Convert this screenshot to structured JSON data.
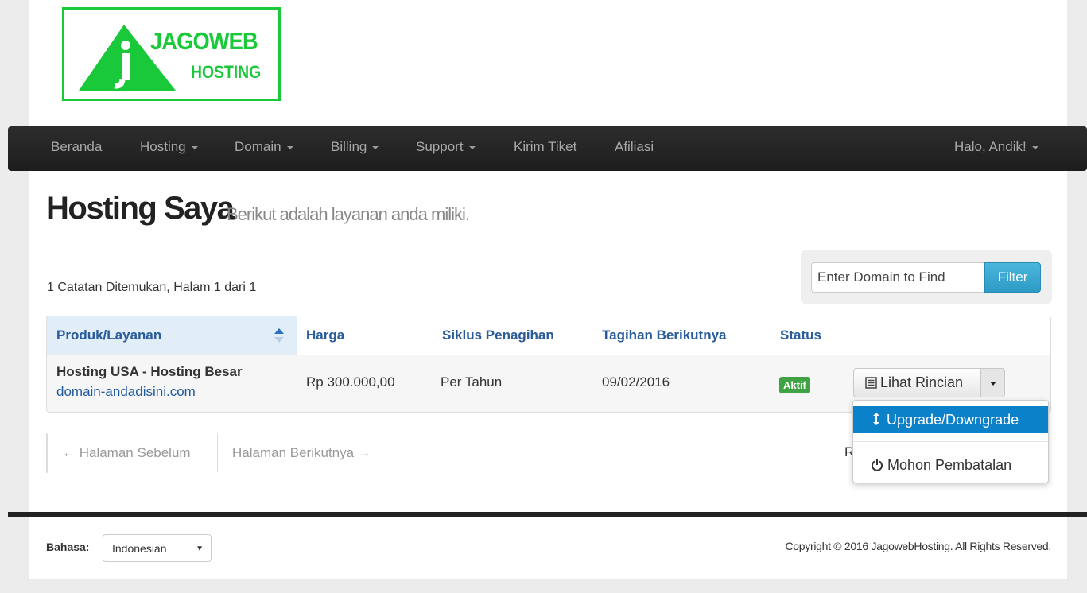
{
  "logo": {
    "line1": "JAGOWEB",
    "line2": "HOSTING",
    "brand_color": "#19c93a"
  },
  "nav": {
    "items": [
      {
        "label": "Beranda"
      },
      {
        "label": "Hosting"
      },
      {
        "label": "Domain"
      },
      {
        "label": "Billing"
      },
      {
        "label": "Support"
      },
      {
        "label": "Kirim Tiket"
      },
      {
        "label": "Afiliasi"
      }
    ],
    "user": "Halo, Andik!"
  },
  "page": {
    "title": "Hosting Saya",
    "subtitle": "Berikut adalah layanan anda miliki."
  },
  "records": "1 Catatan Ditemukan, Halam 1 dari 1",
  "filter": {
    "placeholder": "Enter Domain to Find",
    "button": "Filter"
  },
  "table": {
    "headers": [
      "Produk/Layanan",
      "Harga",
      "Siklus Penagihan",
      "Tagihan Berikutnya",
      "Status"
    ],
    "rows": [
      {
        "product": "Hosting USA - Hosting Besar",
        "domain": "domain-andadisini.com",
        "price": "Rp 300.000,00",
        "cycle": "Per Tahun",
        "next_due": "09/02/2016",
        "status": "Aktif",
        "action": "Lihat Rincian"
      }
    ]
  },
  "dropdown": {
    "upgrade": "Upgrade/Downgrade",
    "cancel": "Mohon Pembatalan"
  },
  "pagination": {
    "prev": "← Halaman Sebelum",
    "next": "Halaman Berikutnya →",
    "partial": "R"
  },
  "footer": {
    "lang_label": "Bahasa:",
    "lang_value": "Indonesian",
    "copyright": "Copyright © 2016 JagowebHosting. All Rights Reserved."
  }
}
